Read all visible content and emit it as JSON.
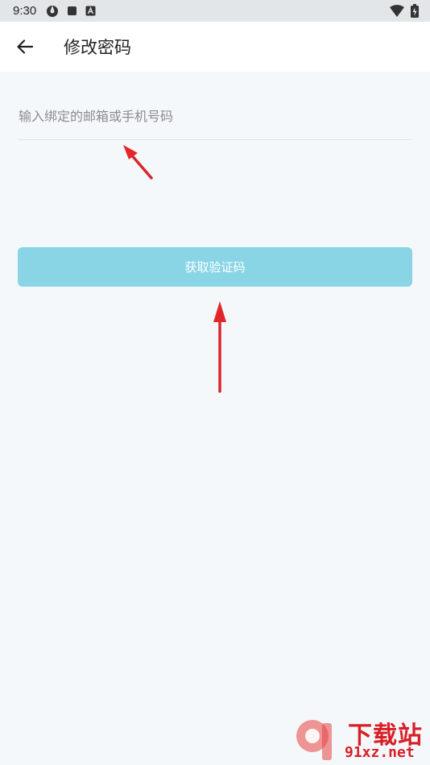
{
  "status_bar": {
    "time": "9:30"
  },
  "header": {
    "title": "修改密码"
  },
  "form": {
    "account_placeholder": "输入绑定的邮箱或手机号码",
    "account_value": "",
    "submit_label": "获取验证码"
  },
  "colors": {
    "accent": "#89d5e6",
    "annotation_arrow": "#e3262a"
  },
  "watermark": {
    "brand_cn": "下载站",
    "brand_url": "91xz.net"
  }
}
